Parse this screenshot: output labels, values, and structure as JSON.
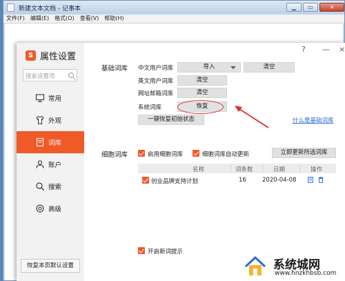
{
  "notepad": {
    "title": "新建文本文档 - 记事本",
    "menu": [
      "文件(F)",
      "编辑(E)",
      "格式(O)",
      "查看(V)",
      "帮助(H)"
    ]
  },
  "dialog": {
    "title": "属性设置",
    "logo_letter": "S",
    "help": "?",
    "minimize": "—",
    "close": "×",
    "search_placeholder": "搜索设置项",
    "nav": [
      {
        "label": "常用",
        "icon": "monitor-icon"
      },
      {
        "label": "外观",
        "icon": "shirt-icon"
      },
      {
        "label": "词库",
        "icon": "book-icon",
        "active": true
      },
      {
        "label": "账户",
        "icon": "user-icon"
      },
      {
        "label": "搜索",
        "icon": "search-icon"
      },
      {
        "label": "高级",
        "icon": "gear-icon"
      }
    ],
    "reset_page": "恢复本页默认设置"
  },
  "basic": {
    "title": "基础词库",
    "cn_label": "中文用户词库",
    "cn_import": "导入",
    "cn_clear": "清空",
    "en_label": "英文用户词库",
    "en_clear": "清空",
    "url_label": "网址邮箱词库",
    "url_clear": "清空",
    "sys_label": "系统词库",
    "sys_restore": "恢复",
    "restore_all": "一键恢复初始状态",
    "what_link": "什么是基础词库"
  },
  "cell": {
    "title": "细胞词库",
    "enable": "启用细胞词库",
    "auto_update": "细胞词库自动更新",
    "update_now": "立即更新所选词库",
    "columns": [
      "名称",
      "词条数",
      "日期",
      "操作"
    ],
    "rows": [
      {
        "name": "创业品牌支持计划",
        "count": "16",
        "date": "2020-04-08"
      }
    ],
    "new_word_tip": "开启新词提示"
  },
  "watermark": {
    "text": "系统城网",
    "url": "www.hnzkhbsb.com"
  },
  "colors": {
    "accent": "#f05a28",
    "link": "#2a6ad8",
    "callout": "#e0302b"
  }
}
